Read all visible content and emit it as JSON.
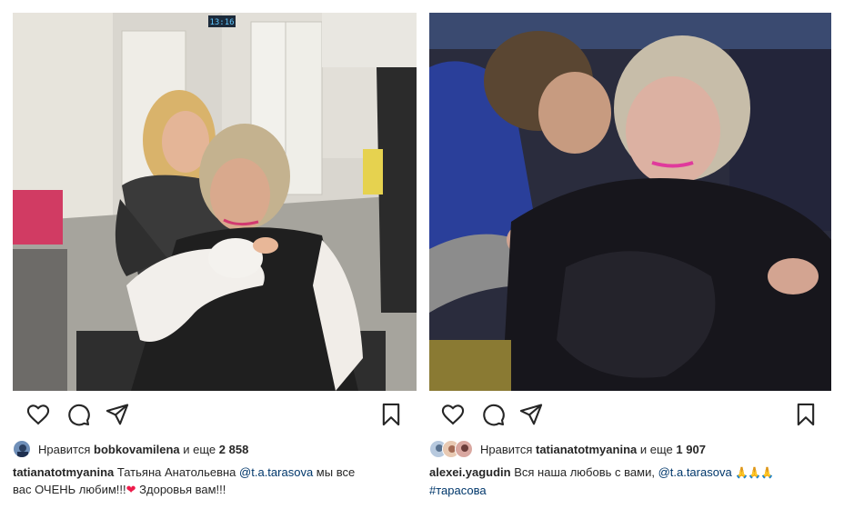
{
  "posts": [
    {
      "liked_by_prefix": "Нравится",
      "liked_by_user": "bobkovamilena",
      "liked_by_and": "и еще",
      "liked_count": "2 858",
      "caption_user": "tatianatotmyanina",
      "caption_text_1": "Татьяна Анатольевна",
      "caption_mention": "@t.a.tarasova",
      "caption_text_2": "мы все",
      "caption_text_3": "вас ОЧЕНЬ любим!!!",
      "caption_emoji": "❤",
      "caption_text_4": "Здоровья вам!!!",
      "photo_clock": "13:16"
    },
    {
      "liked_by_prefix": "Нравится",
      "liked_by_user": "tatianatotmyanina",
      "liked_by_and": "и еще",
      "liked_count": "1 907",
      "caption_user": "alexei.yagudin",
      "caption_text_1": "Вся наша любовь с вами,",
      "caption_mention": "@t.a.tarasova",
      "caption_emoji": "🙏🙏🙏",
      "caption_hashtag": "#тарасова"
    }
  ],
  "icons": {
    "like": "heart-icon",
    "comment": "comment-icon",
    "share": "send-icon",
    "save": "bookmark-icon"
  },
  "colors": {
    "text": "#262626",
    "link": "#00376b",
    "heart": "#ed1c4b"
  }
}
